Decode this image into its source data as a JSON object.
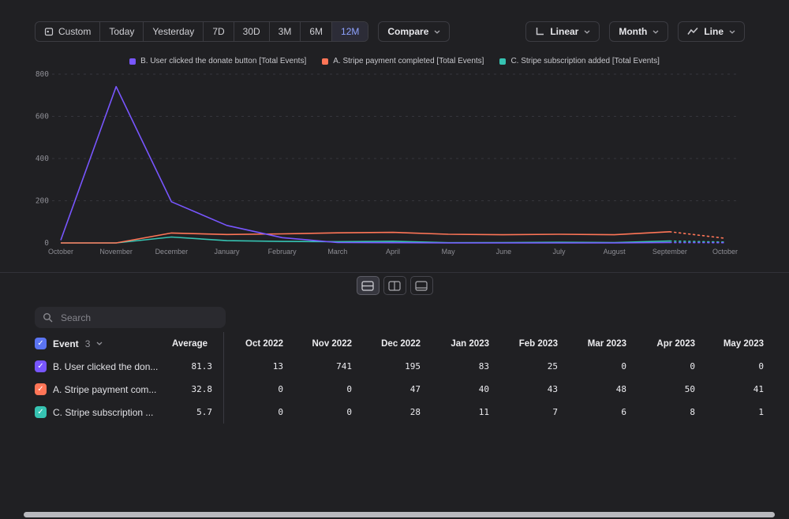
{
  "toolbar": {
    "ranges": [
      "Custom",
      "Today",
      "Yesterday",
      "7D",
      "30D",
      "3M",
      "6M",
      "12M"
    ],
    "selected_range": "12M",
    "compare_label": "Compare",
    "linear_label": "Linear",
    "month_label": "Month",
    "line_label": "Line"
  },
  "legend": {
    "items": [
      {
        "label": "B. User clicked the donate button [Total Events]",
        "color": "#7856ff"
      },
      {
        "label": "A. Stripe payment completed [Total Events]",
        "color": "#ff7557"
      },
      {
        "label": "C. Stripe subscription added [Total Events]",
        "color": "#36c3b2"
      }
    ]
  },
  "chart_data": {
    "type": "line",
    "x": [
      "October",
      "November",
      "December",
      "January",
      "February",
      "March",
      "April",
      "May",
      "June",
      "July",
      "August",
      "September",
      "October"
    ],
    "series": [
      {
        "name": "C. Stripe subscription added [Total Events]",
        "color": "#36c3b2",
        "values": [
          0,
          0,
          28,
          11,
          7,
          6,
          8,
          1,
          2,
          3,
          2,
          9,
          4
        ]
      },
      {
        "name": "A. Stripe payment completed [Total Events]",
        "color": "#ff7557",
        "values": [
          0,
          0,
          47,
          40,
          43,
          48,
          50,
          41,
          39,
          41,
          39,
          53,
          22
        ]
      },
      {
        "name": "B. User clicked the donate button [Total Events]",
        "color": "#7856ff",
        "values": [
          13,
          741,
          195,
          83,
          25,
          2,
          1,
          0,
          0,
          0,
          0,
          2,
          1
        ]
      }
    ],
    "title": "",
    "xlabel": "",
    "ylabel": "",
    "ylim": [
      0,
      800
    ],
    "yticks": [
      0,
      200,
      400,
      600,
      800
    ],
    "grid": "dashed-horizontal",
    "last_segment_dashed": true,
    "legend_position": "top"
  },
  "search": {
    "placeholder": "Search"
  },
  "table": {
    "event_label": "Event",
    "event_count": "3",
    "average_label": "Average",
    "select_all_color": "#5b74f2",
    "check_glyph": "✓",
    "columns": [
      "Oct 2022",
      "Nov 2022",
      "Dec 2022",
      "Jan 2023",
      "Feb 2023",
      "Mar 2023",
      "Apr 2023",
      "May 2023"
    ],
    "rows": [
      {
        "name": "B. User clicked the don...",
        "color": "#7856ff",
        "average": "81.3",
        "values": [
          "13",
          "741",
          "195",
          "83",
          "25",
          "0",
          "0",
          "0"
        ]
      },
      {
        "name": "A. Stripe payment com...",
        "color": "#ff7557",
        "average": "32.8",
        "values": [
          "0",
          "0",
          "47",
          "40",
          "43",
          "48",
          "50",
          "41"
        ]
      },
      {
        "name": "C. Stripe subscription ...",
        "color": "#36c3b2",
        "average": "5.7",
        "values": [
          "0",
          "0",
          "28",
          "11",
          "7",
          "6",
          "8",
          "1"
        ]
      }
    ]
  }
}
